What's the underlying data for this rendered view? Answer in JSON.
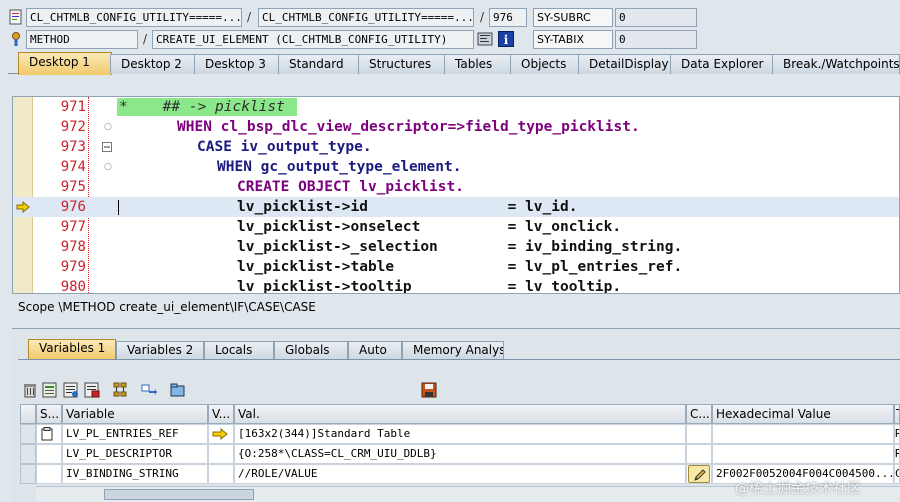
{
  "header": {
    "program": "CL_CHTMLB_CONFIG_UTILITY=====...",
    "include": "CL_CHTMLB_CONFIG_UTILITY=====...",
    "line": "976",
    "event_type": "METHOD",
    "event": "CREATE_UI_ELEMENT (CL_CHTMLB_CONFIG_UTILITY)",
    "sy_fields": [
      {
        "name": "SY-SUBRC",
        "value": "0"
      },
      {
        "name": "SY-TABIX",
        "value": "0"
      }
    ]
  },
  "desktop_tabs": [
    "Desktop 1",
    "Desktop 2",
    "Desktop 3",
    "Standard",
    "Structures",
    "Tables",
    "Objects",
    "DetailDisplay",
    "Data Explorer",
    "Break./Watchpoints"
  ],
  "code": {
    "lines": [
      {
        "num": "971",
        "text": "*    ## -> picklist"
      },
      {
        "num": "972",
        "text": "WHEN cl_bsp_dlc_view_descriptor=>field_type_picklist."
      },
      {
        "num": "973",
        "text": "CASE iv_output_type."
      },
      {
        "num": "974",
        "text": "WHEN gc_output_type_element."
      },
      {
        "num": "975",
        "text": "CREATE OBJECT lv_picklist."
      },
      {
        "num": "976",
        "text": "lv_picklist->id                = lv_id."
      },
      {
        "num": "977",
        "text": "lv_picklist->onselect          = lv_onclick."
      },
      {
        "num": "978",
        "text": "lv_picklist->_selection        = iv_binding_string."
      },
      {
        "num": "979",
        "text": "lv_picklist->table             = lv_pl_entries_ref."
      },
      {
        "num": "980",
        "text": "lv_picklist->tooltip           = lv_tooltip."
      }
    ]
  },
  "scope": "Scope \\METHOD create_ui_element\\IF\\CASE\\CASE",
  "var_tabs": [
    "Variables 1",
    "Variables 2",
    "Locals",
    "Globals",
    "Auto",
    "Memory Analysis"
  ],
  "grid": {
    "columns": [
      "S...",
      "Variable",
      "V...",
      "Val.",
      "C...",
      "Hexadecimal Value",
      "T"
    ],
    "rows": [
      {
        "variable": "LV_PL_ENTRIES_REF",
        "value": "[163x2(344)]Standard Table",
        "hex": "",
        "type": "R"
      },
      {
        "variable": "LV_PL_DESCRIPTOR",
        "value": "{O:258*\\CLASS=CL_CRM_UIU_DDLB}",
        "hex": "",
        "type": "R"
      },
      {
        "variable": "IV_BINDING_STRING",
        "value": "//ROLE/VALUE",
        "hex": "2F002F0052004F004C004500...",
        "type": "C"
      }
    ]
  },
  "watermark": "@稀土掘金技术社区"
}
